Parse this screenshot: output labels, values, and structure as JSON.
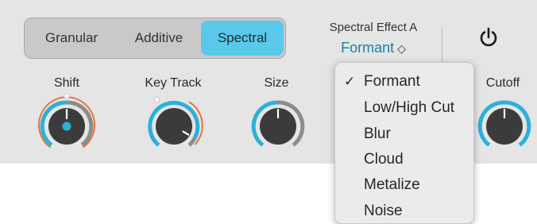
{
  "mode_selector": {
    "options": [
      "Granular",
      "Additive",
      "Spectral"
    ],
    "selected": "Spectral",
    "accent_color": "#5ac8ea"
  },
  "spectral_effect": {
    "title": "Spectral Effect A",
    "value": "Formant",
    "chevron": "⌃⌄",
    "value_color": "#1c7fa8"
  },
  "power_button": {
    "icon": "power-icon"
  },
  "knobs": [
    {
      "label": "Shift",
      "value": 0.5,
      "modulation_range": 0.35,
      "mod_color": "#e8733a",
      "value_color": "#2bb1d8"
    },
    {
      "label": "Key Track",
      "value": 0.8,
      "modulation_range": 0.2
    },
    {
      "label": "Size",
      "value": 0.5
    },
    {
      "label": "Cutoff",
      "value": 0.5
    }
  ],
  "effect_menu": {
    "items": [
      "Formant",
      "Low/High Cut",
      "Blur",
      "Cloud",
      "Metalize",
      "Noise"
    ],
    "checked": "Formant",
    "check_glyph": "✓"
  }
}
